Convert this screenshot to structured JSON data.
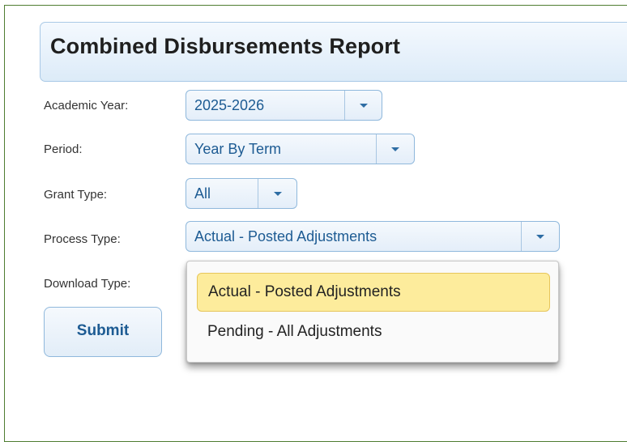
{
  "report": {
    "title": "Combined Disbursements Report"
  },
  "form": {
    "academic_year": {
      "label": "Academic Year:",
      "value": "2025-2026"
    },
    "period": {
      "label": "Period:",
      "value": "Year By Term"
    },
    "grant_type": {
      "label": "Grant Type:",
      "value": "All"
    },
    "process_type": {
      "label": "Process Type:",
      "value": "Actual - Posted Adjustments",
      "options": [
        "Actual - Posted Adjustments",
        "Pending - All Adjustments"
      ],
      "expanded": true
    },
    "download_type": {
      "label": "Download Type:"
    },
    "submit_label": "Submit"
  },
  "colors": {
    "frame_border": "#4f7d31",
    "accent_text": "#1d5b93",
    "highlight": "#fdec9c"
  },
  "icons": {
    "dropdown_arrow": "chevron-down-icon"
  }
}
